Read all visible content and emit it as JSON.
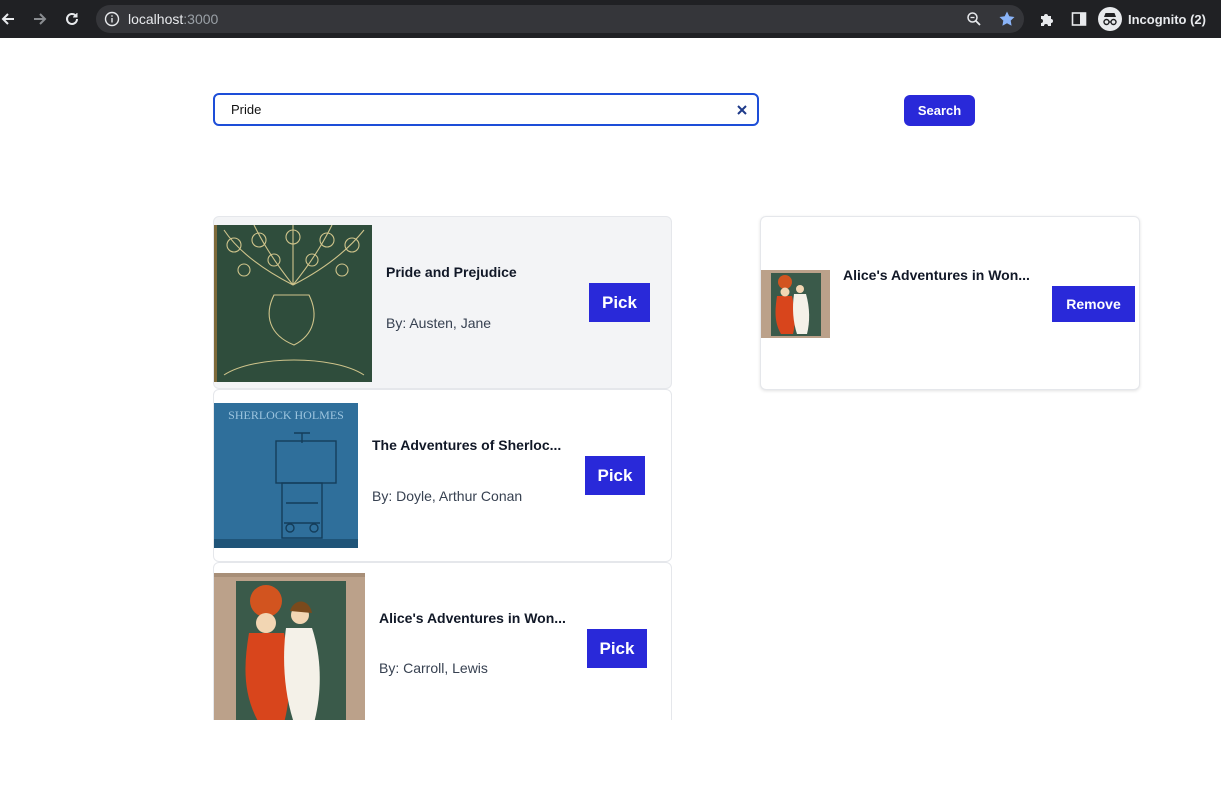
{
  "browser": {
    "url_host": "localhost",
    "url_port": ":3000",
    "profile_label": "Incognito (2)"
  },
  "search": {
    "value": "Pride",
    "button_label": "Search"
  },
  "results": [
    {
      "title": "Pride and Prejudice",
      "author": "By: Austen, Jane",
      "pick_label": "Pick",
      "cover": "peacock-cover"
    },
    {
      "title": "The Adventures of Sherloc...",
      "author": "By: Doyle, Arthur Conan",
      "pick_label": "Pick",
      "cover": "sherlock-cover",
      "cover_text": "SHERLOCK HOLMES"
    },
    {
      "title": "Alice's Adventures in Won...",
      "author": "By: Carroll, Lewis",
      "pick_label": "Pick",
      "cover": "alice-cover"
    }
  ],
  "selected": [
    {
      "title": "Alice's Adventures in Won...",
      "remove_label": "Remove",
      "cover": "alice-cover"
    }
  ],
  "colors": {
    "primary": "#2929d9",
    "focus_border": "#1d4ed8",
    "chrome_bg": "#202124"
  }
}
